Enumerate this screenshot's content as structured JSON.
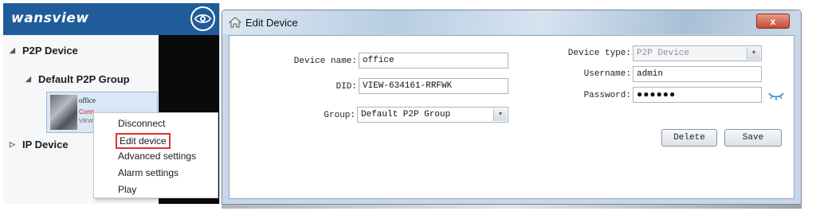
{
  "sidebar": {
    "brand": "wansview",
    "tree": {
      "p2p_device": "P2P Device",
      "default_group": "Default P2P Group",
      "ip_device": "IP Device"
    },
    "device_tile": {
      "name": "office",
      "status": "Conn",
      "sub": "VIEW"
    },
    "context_menu": [
      "Disconnect",
      "Edit device",
      "Advanced settings",
      "Alarm settings",
      "Play"
    ],
    "highlighted_item": "Edit device"
  },
  "dialog": {
    "title": "Edit Device",
    "close_label": "x",
    "device_name_label": "Device name:",
    "device_name_value": "office",
    "did_label": "DID:",
    "did_value": "VIEW-634161-RRFWK",
    "group_label": "Group:",
    "group_value": "Default P2P Group",
    "device_type_label": "Device type:",
    "device_type_value": "P2P Device",
    "username_label": "Username:",
    "username_value": "admin",
    "password_label": "Password:",
    "password_value": "●●●●●●",
    "delete_label": "Delete",
    "save_label": "Save"
  },
  "colors": {
    "brand_bar": "#1f5c99",
    "highlight_border": "#e53030",
    "close_button": "#c74a34",
    "device_status": "#d02020"
  },
  "icons": [
    "eye-icon",
    "home-icon",
    "close-icon",
    "chevron-down-icon",
    "eye-toggle-icon",
    "tree-expand-icon"
  ]
}
